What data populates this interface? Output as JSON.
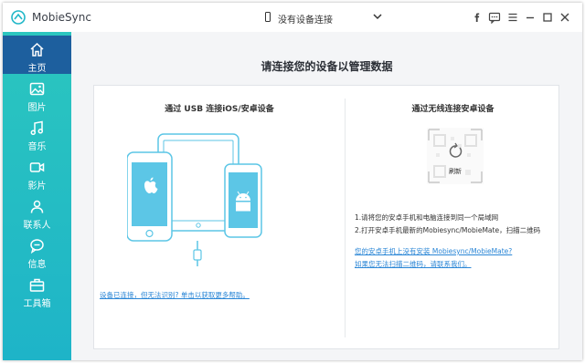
{
  "app": {
    "title": "MobieSync",
    "device_selector": "没有设备连接"
  },
  "sidebar": {
    "items": [
      {
        "label": "主页",
        "icon": "home-icon",
        "active": true
      },
      {
        "label": "图片",
        "icon": "photo-icon"
      },
      {
        "label": "音乐",
        "icon": "music-icon"
      },
      {
        "label": "影片",
        "icon": "video-icon"
      },
      {
        "label": "联系人",
        "icon": "contacts-icon"
      },
      {
        "label": "信息",
        "icon": "message-icon"
      },
      {
        "label": "工具箱",
        "icon": "toolbox-icon"
      }
    ]
  },
  "main": {
    "title": "请连接您的设备以管理数据",
    "usb": {
      "title": "通过 USB 连接iOS/安卓设备",
      "help_link": "设备已连接，但无法识别? 单击以获取更多帮助。"
    },
    "wifi": {
      "title": "通过无线连接安卓设备",
      "refresh": "刷新",
      "instructions": [
        "1.请将您的安卓手机和电脑连接到同一个局域网",
        "2.打开安卓手机最新的Mobiesync/MobieMate，扫描二维码"
      ],
      "links": [
        "您的安卓手机上没有安装 Mobiesync/MobieMate?",
        "如果您无法扫描二维码，请联系我们。"
      ]
    }
  },
  "colors": {
    "sidebar_gradient_top": "#2bc6bf",
    "sidebar_gradient_bottom": "#1eb4c8",
    "active_item": "#1d5f9e",
    "link": "#2a86d6",
    "illustration": "#5cc6e6"
  }
}
